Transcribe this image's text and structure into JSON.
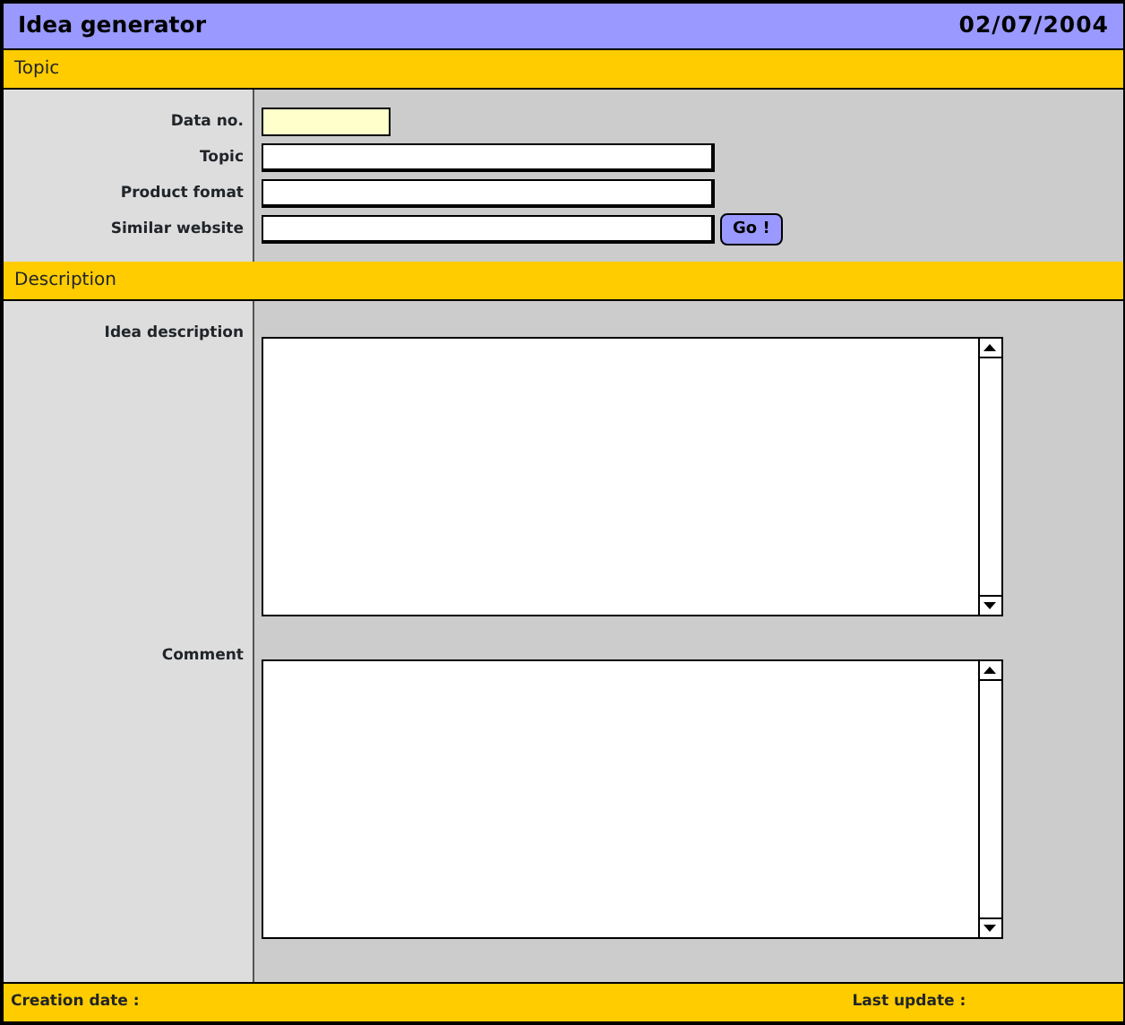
{
  "window": {
    "title": "Idea generator",
    "date": "02/07/2004"
  },
  "sections": [
    {
      "title": "Topic",
      "fields": [
        {
          "label": "Data no.",
          "kind": "short"
        },
        {
          "label": "Topic",
          "kind": "text"
        },
        {
          "label": "Product fomat",
          "kind": "text"
        },
        {
          "label": "Similar website",
          "kind": "text",
          "button": "Go !"
        }
      ]
    },
    {
      "title": "Description",
      "fields": [
        {
          "label": "Idea description",
          "kind": "textarea"
        },
        {
          "label": "Comment",
          "kind": "textarea"
        }
      ]
    }
  ],
  "footer": {
    "creation_date_label": "Creation date :",
    "last_update_label": "Last update :"
  }
}
